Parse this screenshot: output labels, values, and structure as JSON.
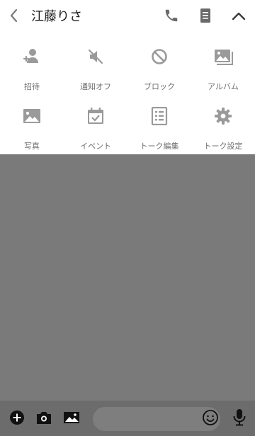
{
  "header": {
    "title": "江藤りさ",
    "back_icon": "chevron-left-icon",
    "call_icon": "phone-icon",
    "notes_icon": "document-icon",
    "collapse_icon": "chevron-up-icon"
  },
  "menu": {
    "items": [
      {
        "label": "招待",
        "icon": "invite-user-icon"
      },
      {
        "label": "通知オフ",
        "icon": "mute-speaker-icon"
      },
      {
        "label": "ブロック",
        "icon": "block-icon"
      },
      {
        "label": "アルバム",
        "icon": "album-icon"
      },
      {
        "label": "写真",
        "icon": "photo-icon"
      },
      {
        "label": "イベント",
        "icon": "calendar-check-icon"
      },
      {
        "label": "トーク編集",
        "icon": "list-edit-icon"
      },
      {
        "label": "トーク設定",
        "icon": "gear-icon"
      }
    ]
  },
  "bottom_bar": {
    "input_value": "",
    "input_placeholder": "",
    "add_icon": "plus-circle-icon",
    "camera_icon": "camera-icon",
    "image_icon": "image-icon",
    "emoji_icon": "smiley-icon",
    "mic_icon": "microphone-icon"
  },
  "colors": {
    "header_bg": "#ffffff",
    "menu_icon": "#9a9a9a",
    "menu_label": "#6f6f6f",
    "chat_bg": "#7a7a7a",
    "bottom_bar_bg": "#6c6c6c",
    "bottom_icon": "#111111"
  }
}
